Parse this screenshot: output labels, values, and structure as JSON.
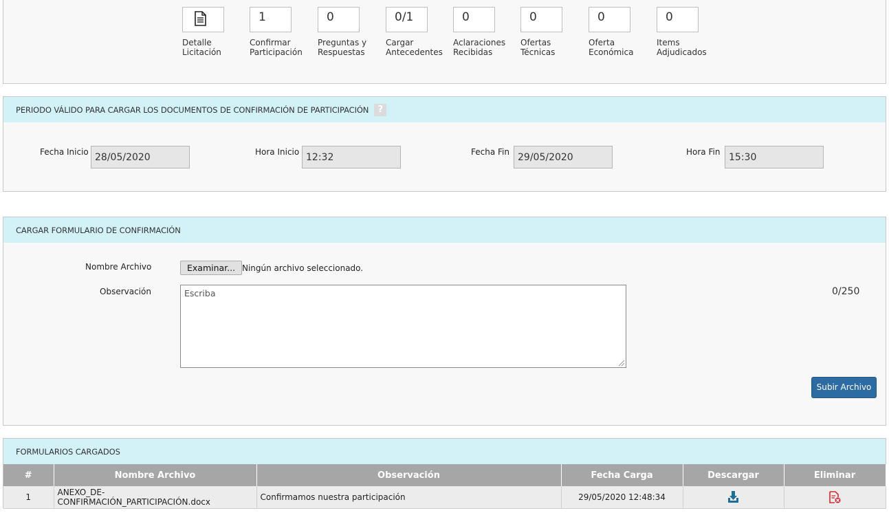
{
  "steps": [
    {
      "value": "",
      "icon": "document-icon",
      "label1": "Detalle",
      "label2": "Licitación"
    },
    {
      "value": "1",
      "label1": "Confirmar",
      "label2": "Participación"
    },
    {
      "value": "0",
      "label1": "Preguntas y",
      "label2": "Respuestas"
    },
    {
      "value": "0/1",
      "label1": "Cargar",
      "label2": "Antecedentes"
    },
    {
      "value": "0",
      "label1": "Aclaraciones",
      "label2": "Recibidas"
    },
    {
      "value": "0",
      "label1": "Ofertas",
      "label2": "Técnicas"
    },
    {
      "value": "0",
      "label1": "Oferta",
      "label2": "Económica"
    },
    {
      "value": "0",
      "label1": "Items",
      "label2": "Adjudicados"
    }
  ],
  "periodo": {
    "title": "PERIODO VÁLIDO PARA CARGAR LOS DOCUMENTOS DE CONFIRMACIÓN DE PARTICIPACIÓN",
    "help": "?",
    "fecha_inicio_label": "Fecha Inicio",
    "fecha_inicio": "28/05/2020",
    "hora_inicio_label": "Hora Inicio",
    "hora_inicio": "12:32",
    "fecha_fin_label": "Fecha Fin",
    "fecha_fin": "29/05/2020",
    "hora_fin_label": "Hora Fin",
    "hora_fin": "15:30"
  },
  "cargar": {
    "title": "CARGAR FORMULARIO DE CONFIRMACIÓN",
    "nombre_label": "Nombre Archivo",
    "browse_label": "Examinar...",
    "file_status": "Ningún archivo seleccionado.",
    "observacion_label": "Observación",
    "observacion_placeholder": "Escriba",
    "counter": "0/250",
    "upload_label": "Subir Archivo"
  },
  "tabla": {
    "title": "FORMULARIOS CARGADOS",
    "headers": [
      "#",
      "Nombre Archivo",
      "Observación",
      "Fecha Carga",
      "Descargar",
      "Eliminar"
    ],
    "rows": [
      {
        "num": "1",
        "archivo": "ANEXO_DE-CONFIRMACIÓN_PARTICIPACIÓN.docx",
        "observacion": "Confirmamos nuestra participación",
        "fecha": "29/05/2020 12:48:34"
      }
    ]
  },
  "colors": {
    "header_bg": "#d2f2f8",
    "accent": "#2d6ca2",
    "delete": "#d9262c",
    "download": "#1e6e9c"
  }
}
